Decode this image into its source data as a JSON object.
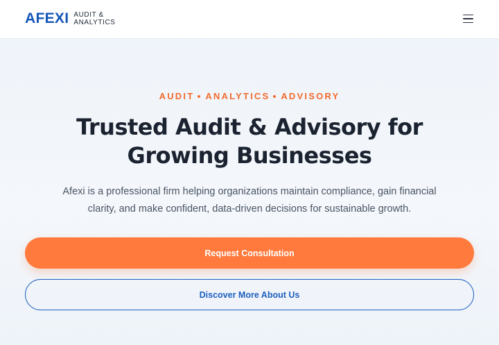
{
  "header": {
    "logo_mark": "AFEXI",
    "logo_tagline_line1": "AUDIT &",
    "logo_tagline_line2": "ANALYTICS",
    "menu_icon": "hamburger-menu-icon"
  },
  "hero": {
    "eyebrow": [
      "AUDIT",
      "ANALYTICS",
      "ADVISORY"
    ],
    "headline_line1": "Trusted Audit & Advisory for",
    "headline_line2": "Growing Businesses",
    "subtext_line1": "Afexi is a professional firm helping organizations maintain compliance, gain financial",
    "subtext_line2": "clarity, and make confident, data-driven decisions for sustainable growth.",
    "primary_cta": "Request Consultation",
    "secondary_cta": "Discover More About Us"
  },
  "colors": {
    "brand_blue": "#1556b8",
    "accent_orange": "#ff7a3c",
    "eyebrow_orange": "#f26b2d"
  }
}
